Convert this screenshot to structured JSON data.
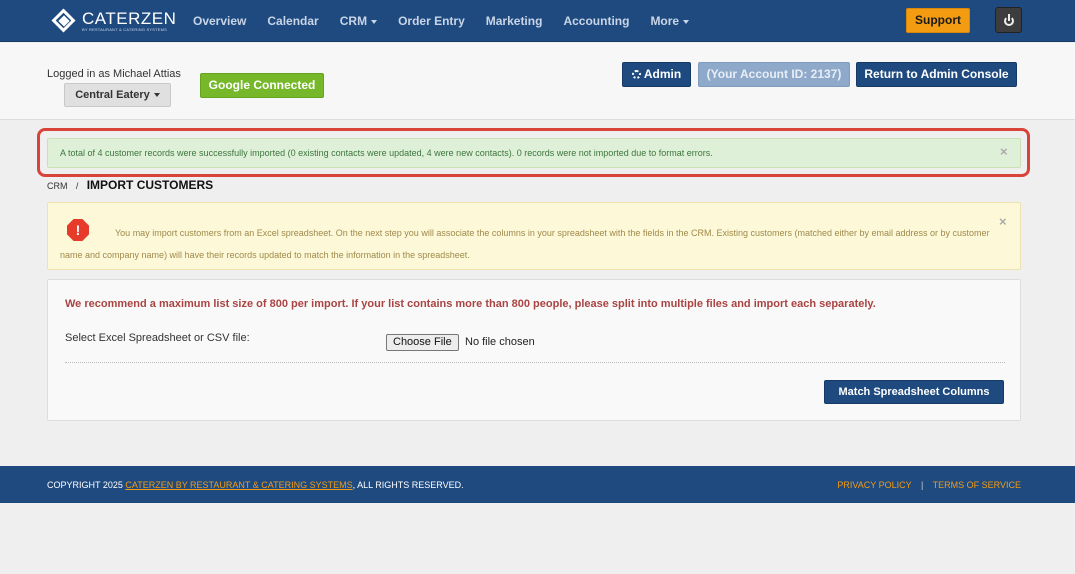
{
  "brand": {
    "name": "CATERZEN",
    "tagline": "BY RESTAURANT & CATERING SYSTEMS"
  },
  "nav": {
    "items": [
      {
        "label": "Overview"
      },
      {
        "label": "Calendar"
      },
      {
        "label": "CRM"
      },
      {
        "label": "Order Entry"
      },
      {
        "label": "Marketing"
      },
      {
        "label": "Accounting"
      },
      {
        "label": "More"
      }
    ],
    "support_label": "Support",
    "power_icon": "power-icon"
  },
  "account": {
    "logged_in_text": "Logged in as Michael Attias",
    "location_label": "Central Eatery",
    "google_label": "Google Connected",
    "admin_label": "Admin",
    "account_id_label": "(Your Account ID: 2137)",
    "return_label": "Return to Admin Console"
  },
  "success_alert": {
    "message": "A total of 4 customer records were successfully imported (0 existing contacts were updated, 4 were new contacts). 0 records were not imported due to format errors.",
    "close": "×"
  },
  "breadcrumb": {
    "root": "CRM",
    "separator": "/",
    "title": "IMPORT CUSTOMERS"
  },
  "warning": {
    "icon_text": "!",
    "message": "You may import customers from an Excel spreadsheet. On the next step you will associate the columns in your spreadsheet with the fields in the CRM. Existing customers (matched either by email address or by customer name and company name) will have their records updated to match the information in the spreadsheet.",
    "close": "×"
  },
  "import_panel": {
    "recommendation": "We recommend a maximum list size of 800 per import. If your list contains more than 800 people, please split into multiple files and import each separately.",
    "file_label": "Select Excel Spreadsheet or CSV file:",
    "choose_file_label": "Choose File",
    "no_file_text": "No file chosen",
    "match_button_label": "Match Spreadsheet Columns"
  },
  "footer": {
    "copyright_prefix": "COPYRIGHT 2025 ",
    "copyright_link": "CATERZEN BY RESTAURANT & CATERING SYSTEMS",
    "copyright_suffix": ", ALL RIGHTS RESERVED.",
    "privacy_label": "PRIVACY POLICY",
    "separator": "|",
    "terms_label": "TERMS OF SERVICE"
  },
  "colors": {
    "nav_bg": "#1e4a80",
    "support": "#f39c12",
    "google": "#76b82a",
    "success_bg": "#dff0d8",
    "warning_bg": "#fcf8d8",
    "error_text": "#a94442",
    "highlight": "#d9443a"
  }
}
